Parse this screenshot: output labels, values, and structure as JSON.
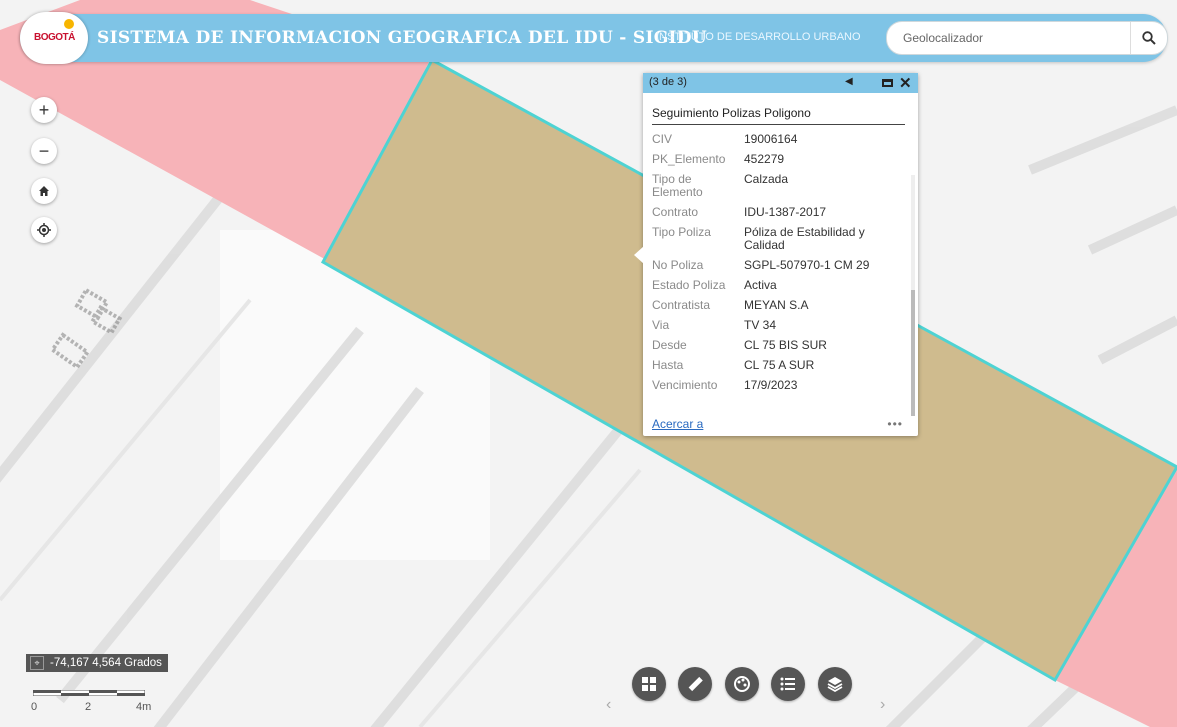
{
  "header": {
    "logo_text": "BOGOTÁ",
    "title": "SISTEMA DE INFORMACION GEOGRAFICA DEL IDU - SIGIDU",
    "subtitle": "INSTITUTO DE DESARROLLO URBANO",
    "search_placeholder": "Geolocalizador"
  },
  "map_controls": {
    "zoom_in": "+",
    "zoom_out": "−"
  },
  "popup": {
    "count": "(3 de 3)",
    "title": "Seguimiento Polizas Poligono",
    "fields": [
      {
        "key": "CIV",
        "value": "19006164"
      },
      {
        "key": "PK_Elemento",
        "value": "452279"
      },
      {
        "key": "Tipo de Elemento",
        "value": "Calzada"
      },
      {
        "key": "Contrato",
        "value": "IDU-1387-2017"
      },
      {
        "key": "Tipo Poliza",
        "value": "Póliza de Estabilidad y Calidad"
      },
      {
        "key": "No Poliza",
        "value": "SGPL-507970-1 CM 29"
      },
      {
        "key": "Estado Poliza",
        "value": "Activa"
      },
      {
        "key": "Contratista",
        "value": "MEYAN S.A"
      },
      {
        "key": "Via",
        "value": "TV 34"
      },
      {
        "key": "Desde",
        "value": "CL 75 BIS SUR"
      },
      {
        "key": "Hasta",
        "value": "CL 75 A SUR"
      },
      {
        "key": "Vencimiento",
        "value": "17/9/2023"
      }
    ],
    "zoom_link": "Acercar a",
    "more": "•••"
  },
  "coordinates": "-74,167 4,564 Grados",
  "scale": {
    "labels": [
      "0",
      "2",
      "4m"
    ]
  },
  "toolbar": {
    "buttons": [
      "basemap-gallery",
      "measure",
      "draw",
      "legend",
      "layer-list"
    ]
  },
  "colors": {
    "header": "#7fc4e6",
    "polygon_fill": "#cfbb8e",
    "polygon_stroke": "#4ed3d3",
    "road_pink": "#f7b3b8"
  }
}
